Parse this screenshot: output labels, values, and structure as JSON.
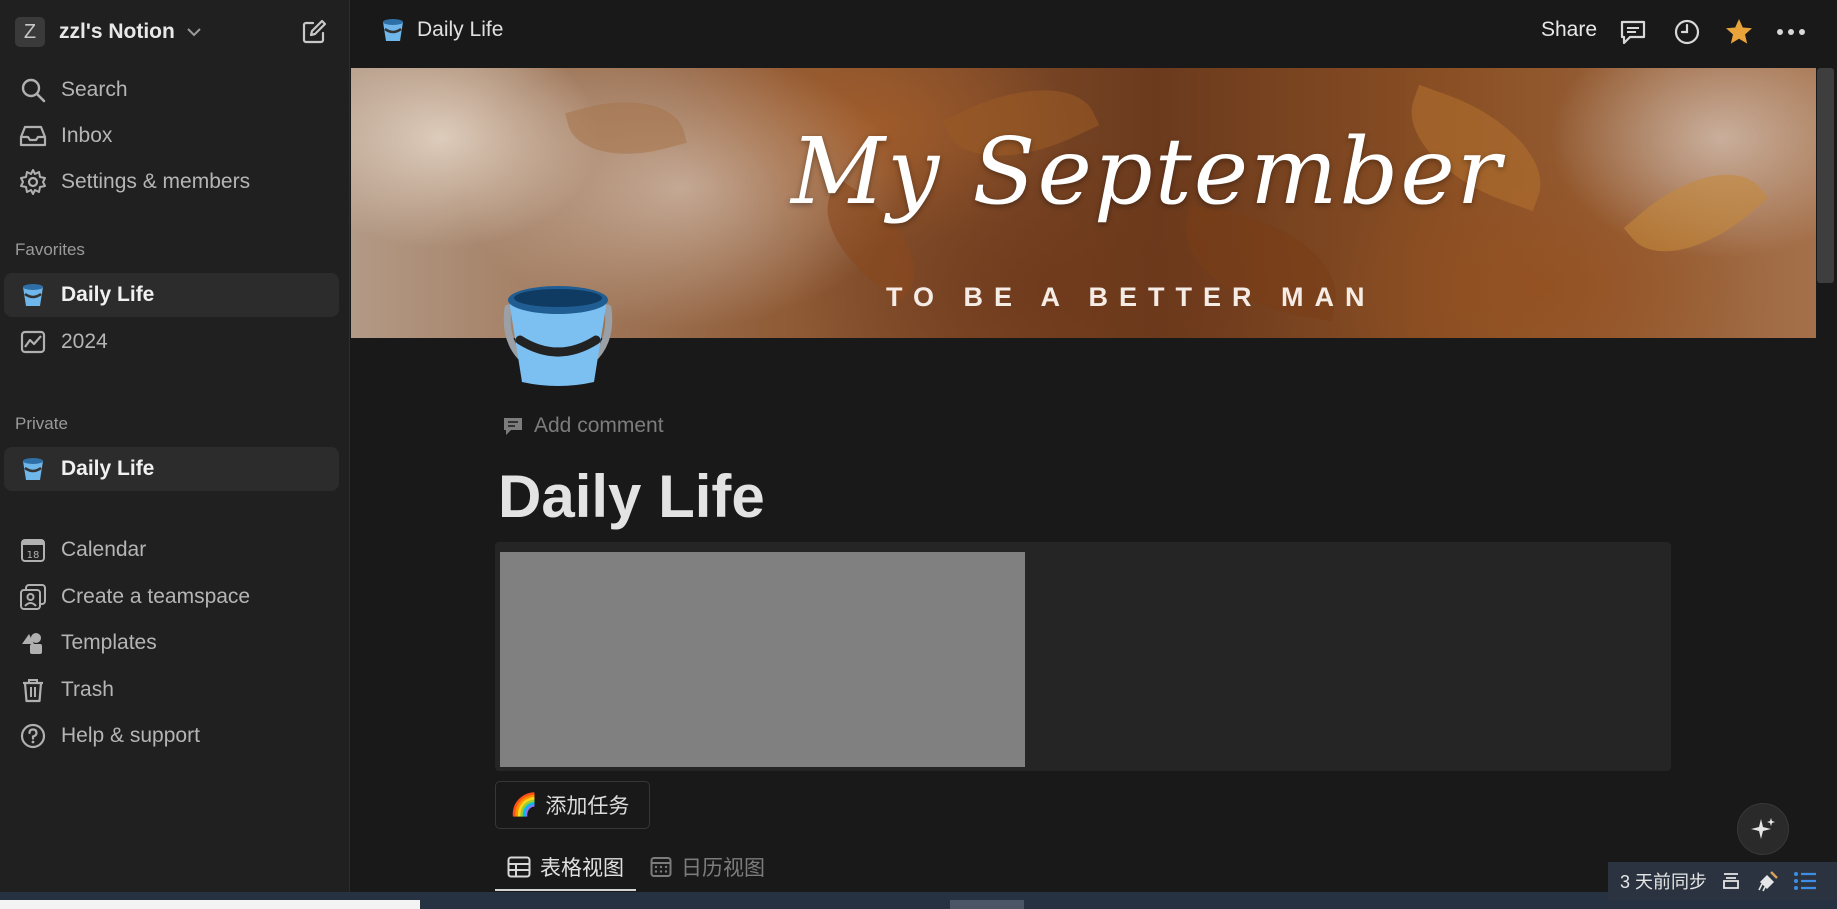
{
  "workspace": {
    "avatar_letter": "Z",
    "name": "zzl's Notion"
  },
  "sidebar": {
    "top_items": [
      {
        "label": "Search",
        "icon": "search-icon"
      },
      {
        "label": "Inbox",
        "icon": "inbox-icon"
      },
      {
        "label": "Settings & members",
        "icon": "gear-icon"
      }
    ],
    "favorites_label": "Favorites",
    "favorites": [
      {
        "label": "Daily Life",
        "icon": "bucket-icon"
      },
      {
        "label": "2024",
        "icon": "chart-icon"
      }
    ],
    "private_label": "Private",
    "private": [
      {
        "label": "Daily Life",
        "icon": "bucket-icon"
      }
    ],
    "bottom_items": [
      {
        "label": "Calendar",
        "icon": "calendar-icon"
      },
      {
        "label": "Create a teamspace",
        "icon": "teamspace-icon"
      },
      {
        "label": "Templates",
        "icon": "templates-icon"
      },
      {
        "label": "Trash",
        "icon": "trash-icon"
      },
      {
        "label": "Help & support",
        "icon": "help-icon"
      }
    ]
  },
  "topbar": {
    "breadcrumb": "Daily Life",
    "share_label": "Share"
  },
  "cover": {
    "title": "My September",
    "subtitle": "TO BE A BETTER MAN"
  },
  "page": {
    "add_comment": "Add comment",
    "title": "Daily Life",
    "add_task_button": "添加任务",
    "add_task_emoji": "🌈",
    "views": [
      {
        "label": "表格视图",
        "active": true
      },
      {
        "label": "日历视图",
        "active": false
      }
    ]
  },
  "status": {
    "sync_text": "3 天前同步"
  },
  "colors": {
    "background": "#191919",
    "sidebar": "#202020",
    "favorite_star": "#e8a33a",
    "bucket_blue": "#5fa8e0"
  }
}
